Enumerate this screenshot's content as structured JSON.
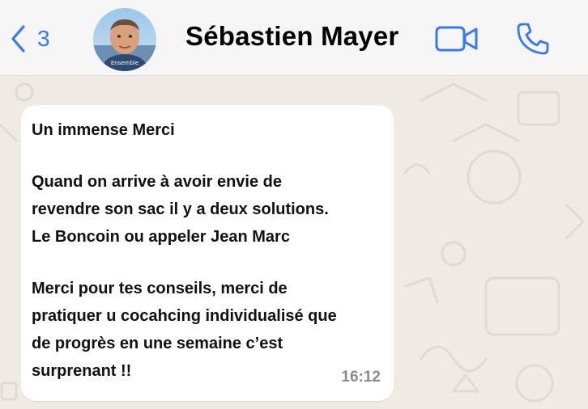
{
  "header": {
    "back_count": "3",
    "contact_name": "Sébastien Mayer",
    "avatar_caption": "Ensemble"
  },
  "message": {
    "paragraphs": [
      [
        "Un immense Merci"
      ],
      [
        "Quand on arrive à avoir envie de",
        "revendre son sac il y a deux solutions.",
        "Le Boncoin ou appeler Jean Marc"
      ],
      [
        "Merci pour tes conseils, merci de",
        "pratiquer u cocahcing individualisé que",
        "de progrès en une semaine c’est",
        "surprenant !!"
      ]
    ],
    "time": "16:12"
  },
  "icons": {
    "back": "chevron-left-icon",
    "video": "video-camera-icon",
    "call": "phone-icon"
  },
  "colors": {
    "accent": "#3478f6",
    "chat_background": "#efeae2",
    "bubble": "#ffffff",
    "timestamp": "#8a8a8a"
  }
}
